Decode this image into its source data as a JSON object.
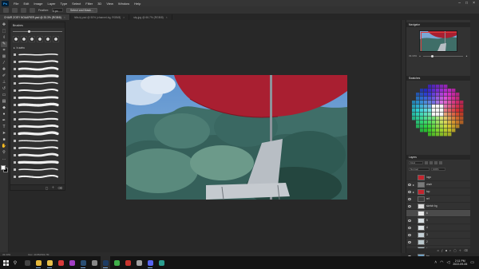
{
  "menu": {
    "app_logo": "Ps",
    "items": [
      "File",
      "Edit",
      "Image",
      "Layer",
      "Type",
      "Select",
      "Filter",
      "3D",
      "View",
      "Window",
      "Help"
    ]
  },
  "options_bar": {
    "label1": "Feather:",
    "value1": "0 px",
    "button": "Select and Mask..."
  },
  "tabs": [
    {
      "label": "CHAIR ZOEY NOAAPIER.psd @ 33.3% (RGB/8)",
      "active": true
    },
    {
      "label": "hills-bj.psd @ 50% (channel-bg, RGB/8)",
      "active": false
    },
    {
      "label": "sky.jpg @ 66.7% (RGB/8)",
      "active": false
    }
  ],
  "tools": [
    "move-icon",
    "marquee-icon",
    "lasso-icon",
    "quick-select-icon",
    "crop-icon",
    "frame-icon",
    "eyedropper-icon",
    "healing-icon",
    "brush-icon",
    "stamp-icon",
    "history-brush-icon",
    "eraser-icon",
    "gradient-icon",
    "blur-icon",
    "dodge-icon",
    "pen-icon",
    "type-icon",
    "path-select-icon",
    "rectangle-icon",
    "hand-icon",
    "zoom-icon",
    "more-icon"
  ],
  "colors": {
    "foreground": "#ffffff",
    "background": "#000000",
    "accent": "#c2252e"
  },
  "brushes": {
    "title": "Brushes",
    "group_name": "b-satru",
    "stroke_count": 18
  },
  "statusbar": {
    "zoom": "33.33%",
    "doc": "Doc: 40.8M/304.7M"
  },
  "navigator": {
    "title": "Navigator",
    "zoom": "33.33%"
  },
  "swatches": {
    "title": "Swatches"
  },
  "layers": {
    "title": "Layers",
    "kind_filter": "Kind",
    "blend_mode": "Normal",
    "opacity": "100%",
    "rows": [
      {
        "name": "logo",
        "thumb": "#c2252e",
        "type": "layer",
        "visible": false,
        "selected": false
      },
      {
        "name": "chair",
        "thumb": "#7a7a7a",
        "type": "folder",
        "visible": true,
        "selected": false
      },
      {
        "name": "top",
        "thumb": "#c2252e",
        "type": "folder",
        "visible": true,
        "selected": false
      },
      {
        "name": "ref",
        "thumb": "#3d3d3d",
        "type": "layer",
        "visible": true,
        "selected": false
      },
      {
        "name": "sketch bg",
        "thumb": "#dcdcdc",
        "type": "layer",
        "visible": true,
        "selected": false
      },
      {
        "name": "6",
        "thumb": "#e7e7e7",
        "type": "layer",
        "visible": false,
        "selected": true
      },
      {
        "name": "5",
        "thumb": "#d8dfe3",
        "type": "layer",
        "visible": true,
        "selected": false
      },
      {
        "name": "4",
        "thumb": "#dce2e5",
        "type": "layer",
        "visible": true,
        "selected": false
      },
      {
        "name": "3",
        "thumb": "#c5d1d7",
        "type": "layer",
        "visible": true,
        "selected": false
      },
      {
        "name": "2",
        "thumb": "#b9c7cc",
        "type": "layer",
        "visible": true,
        "selected": false
      },
      {
        "name": "1",
        "thumb": "#a6b9c0",
        "type": "layer",
        "visible": true,
        "selected": false
      },
      {
        "name": "bg",
        "thumb": "#6f9fc2",
        "type": "layer",
        "visible": true,
        "selected": false
      }
    ]
  },
  "taskbar": {
    "apps": [
      {
        "name": "task-view-icon",
        "color": "#444444",
        "running": false
      },
      {
        "name": "chrome-icon",
        "color": "#e6b83b",
        "running": true
      },
      {
        "name": "file-explorer-icon",
        "color": "#e8c04a",
        "running": true
      },
      {
        "name": "media-player-icon",
        "color": "#d83a3a",
        "running": false
      },
      {
        "name": "app-icon-purple",
        "color": "#a23fc4",
        "running": false
      },
      {
        "name": "steam-icon",
        "color": "#2a4e73",
        "running": true
      },
      {
        "name": "app-icon-grey",
        "color": "#888888",
        "running": false
      },
      {
        "name": "photoshop-icon",
        "color": "#1c3b63",
        "running": true,
        "active": true
      },
      {
        "name": "app-icon-green",
        "color": "#3fae49",
        "running": false
      },
      {
        "name": "app-icon-red",
        "color": "#c8342e",
        "running": false
      },
      {
        "name": "app-icon-grey2",
        "color": "#a1a1a1",
        "running": false
      },
      {
        "name": "discord-icon",
        "color": "#5865f2",
        "running": true
      },
      {
        "name": "app-icon-teal",
        "color": "#2a9d8f",
        "running": false
      }
    ],
    "time": "2:11 PM",
    "date": "2022-09-06"
  }
}
